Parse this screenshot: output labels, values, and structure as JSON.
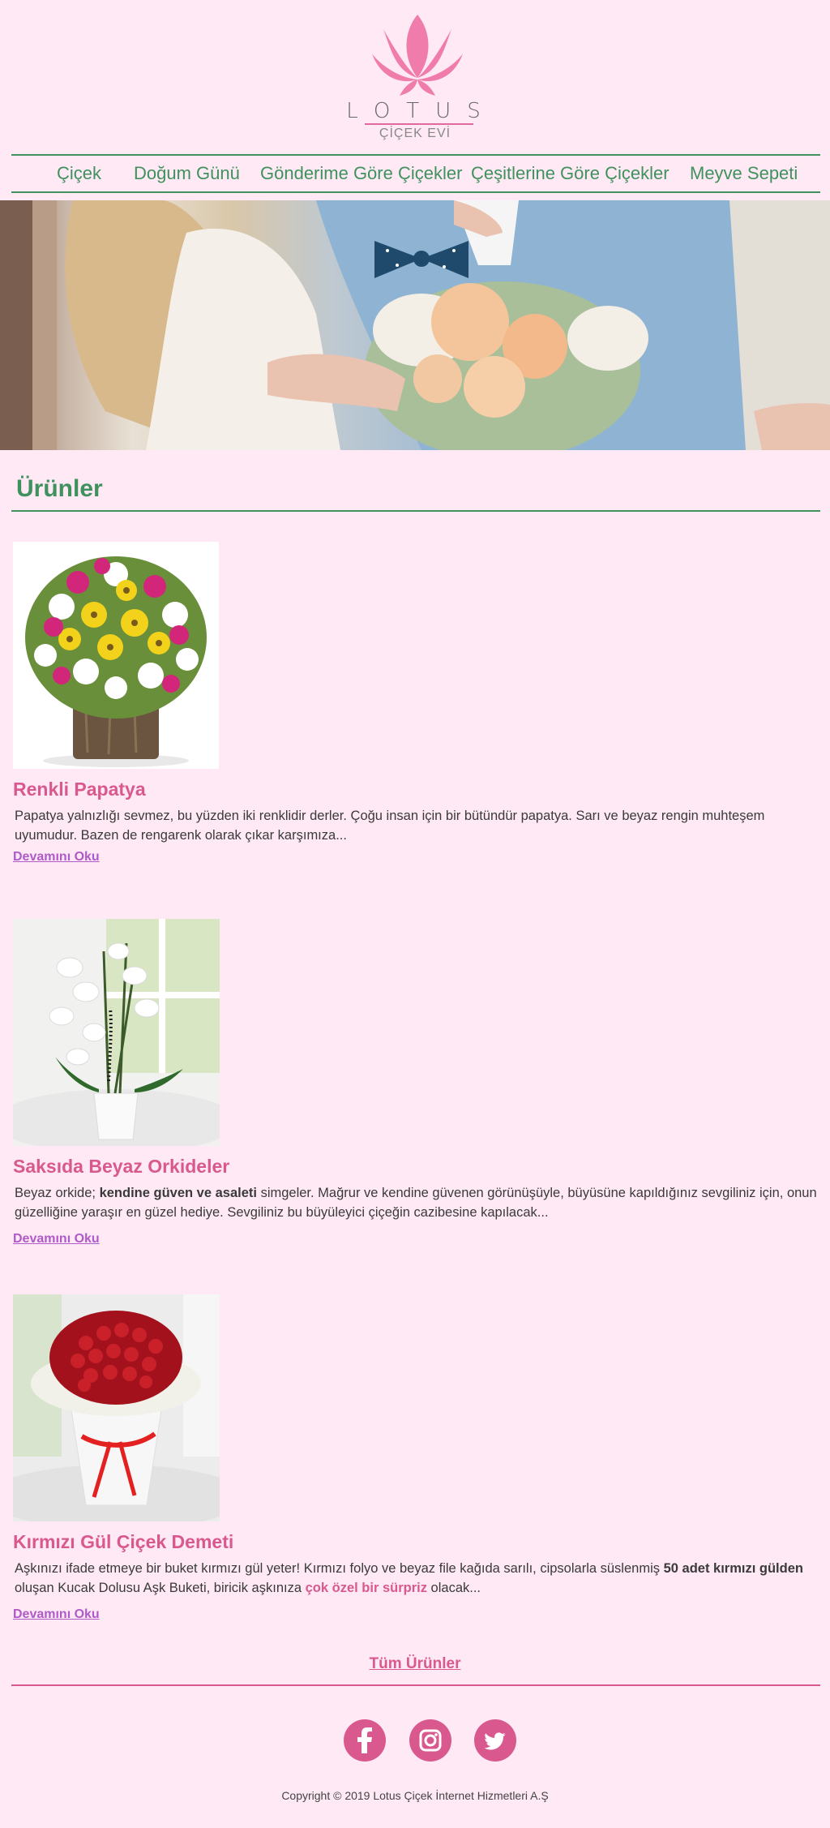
{
  "header": {
    "logo_title": "LOTUS",
    "logo_subtitle": "ÇİÇEK EVİ"
  },
  "nav": {
    "items": [
      {
        "label": "Çiçek"
      },
      {
        "label": "Doğum Günü"
      },
      {
        "label": "Gönderime Göre Çiçekler"
      },
      {
        "label": "Çeşitlerine Göre Çiçekler"
      },
      {
        "label": "Meyve Sepeti"
      }
    ]
  },
  "section": {
    "title": "Ürünler"
  },
  "products": [
    {
      "name": "Renkli Papatya",
      "desc_1": "Papatya yalnızlığı sevmez, bu yüzden iki renklidir derler. Çoğu insan için bir bütündür papatya. Sarı ve beyaz rengin muhteşem uyumudur. Bazen de rengarenk olarak çıkar karşımıza...",
      "read_more": "Devamını Oku"
    },
    {
      "name": "Saksıda Beyaz Orkideler",
      "desc_1": "Beyaz orkide; ",
      "desc_bold": "kendine güven ve asaleti",
      "desc_2": " simgeler. Mağrur ve kendine güvenen görünüşüyle, büyüsüne kapıldığınız sevgiliniz için, onun güzelliğine yaraşır en güzel hediye. Sevgiliniz bu büyüleyici çiçeğin cazibesine kapılacak...",
      "read_more": "Devamını Oku"
    },
    {
      "name": "Kırmızı Gül Çiçek Demeti",
      "desc_1": "Aşkınızı ifade etmeye bir buket kırmızı gül yeter! Kırmızı folyo ve beyaz file kağıda sarılı, cipsolarla süslenmiş ",
      "desc_bold": "50 adet kırmızı gülden",
      "desc_2": " oluşan Kucak Dolusu Aşk Buketi, biricik aşkınıza ",
      "desc_pink": "çok özel bir sürpriz",
      "desc_3": " olacak...",
      "read_more": "Devamını Oku"
    }
  ],
  "all_products": "Tüm Ürünler",
  "social": [
    "facebook-icon",
    "instagram-icon",
    "twitter-icon"
  ],
  "footer": {
    "copyright": "Copyright © 2019 Lotus Çiçek İnternet Hizmetleri A.Ş"
  },
  "colors": {
    "background": "#ffe9f4",
    "green": "#3f915e",
    "pink": "#d9598f",
    "purple_link": "#b05ac9"
  }
}
